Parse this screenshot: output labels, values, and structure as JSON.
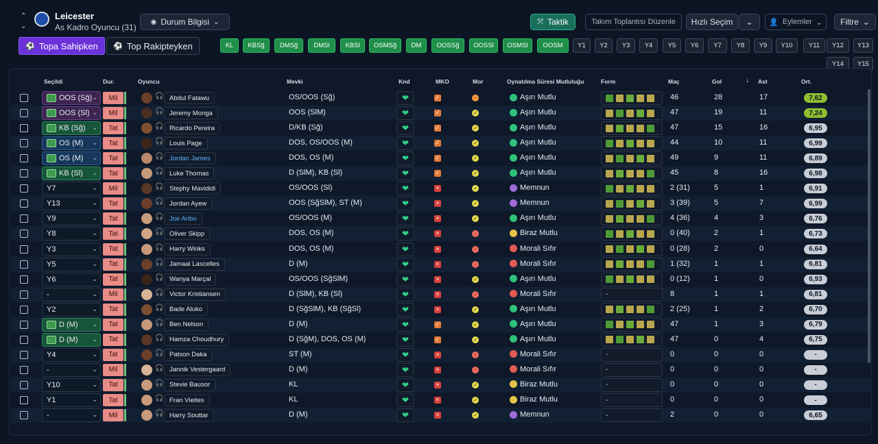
{
  "header": {
    "team": "Leicester",
    "squad": "As Kadro Oyuncu (31)",
    "view": "Durum Bilgisi"
  },
  "toolbar": {
    "tactic": "Taktik",
    "meeting": "Takım Toplantısı Düzenle",
    "quick": "Hızlı Seçim",
    "actions": "Eylemler",
    "filter": "Filtre"
  },
  "toggle": {
    "possession": "Topa Sahipken",
    "opponent": "Top Rakipteyken"
  },
  "formation_pills": [
    {
      "label": "KL",
      "green": true
    },
    {
      "label": "KBSğ",
      "green": true
    },
    {
      "label": "DMSğ",
      "green": true
    },
    {
      "label": "DMSl",
      "green": true
    },
    {
      "label": "KBSl",
      "green": true
    },
    {
      "label": "OSMSğ",
      "green": true
    },
    {
      "label": "DM",
      "green": true
    },
    {
      "label": "OOSSğ",
      "green": true
    },
    {
      "label": "OOSSl",
      "green": true
    },
    {
      "label": "OSMSl",
      "green": true
    },
    {
      "label": "OOSM",
      "green": true
    },
    {
      "label": "Y1",
      "green": false
    },
    {
      "label": "Y2",
      "green": false
    },
    {
      "label": "Y3",
      "green": false
    },
    {
      "label": "Y4",
      "green": false
    },
    {
      "label": "Y5",
      "green": false
    },
    {
      "label": "Y6",
      "green": false
    },
    {
      "label": "Y7",
      "green": false
    },
    {
      "label": "Y8",
      "green": false
    },
    {
      "label": "Y9",
      "green": false
    },
    {
      "label": "Y10",
      "green": false
    },
    {
      "label": "Y11",
      "green": false
    },
    {
      "label": "Y12",
      "green": false
    },
    {
      "label": "Y13",
      "green": false
    },
    {
      "label": "Y14",
      "green": false
    },
    {
      "label": "Y15",
      "green": false
    }
  ],
  "columns": {
    "selected": "Seçildi",
    "dur": "Dur.",
    "player": "Oyuncu",
    "position": "Mevki",
    "knd": "Knd",
    "mko": "MKO",
    "mor": "Mor",
    "playtime": "Oynatılma Süresi Mutluluğu",
    "form": "Form",
    "apps": "Maç",
    "goals": "Gol",
    "assists": "Ast",
    "avg": "Ort."
  },
  "colors": {
    "accent": "#6a32d8",
    "teal": "#1a6e5c",
    "green_pill": "#1f8f4a",
    "rating_high": "#8fbf2f",
    "rating_mid": "#c9ced6"
  },
  "rows": [
    {
      "sel": "OOS (Sğ)",
      "selType": "p",
      "dur": "Mil",
      "name": "Abdul Fatawu",
      "link": false,
      "pos": "OS/OOS (Sğ)",
      "mko": "v",
      "mor": "o",
      "mood": "Aşırı Mutlu",
      "moodType": "g",
      "form": "5",
      "apps": "46",
      "goals": "28",
      "assists": "17",
      "avg": "7,62",
      "hi": true
    },
    {
      "sel": "OOS (Sl)",
      "selType": "p",
      "dur": "Mil",
      "name": "Jeremy Monga",
      "link": false,
      "pos": "OOS (SlM)",
      "mko": "v",
      "mor": "y",
      "mood": "Aşırı Mutlu",
      "moodType": "g",
      "form": "5",
      "apps": "47",
      "goals": "19",
      "assists": "11",
      "avg": "7,24",
      "hi": true
    },
    {
      "sel": "KB (Sğ)",
      "selType": "g",
      "dur": "Tat",
      "name": "Ricardo Pereira",
      "link": false,
      "pos": "D/KB (Sğ)",
      "mko": "v",
      "mor": "y",
      "mood": "Aşırı Mutlu",
      "moodType": "g",
      "form": "5",
      "apps": "47",
      "goals": "15",
      "assists": "16",
      "avg": "6,95",
      "hi": false
    },
    {
      "sel": "OS (M)",
      "selType": "b",
      "dur": "Tat",
      "name": "Louis Page",
      "link": false,
      "pos": "DOS, OS/OOS (M)",
      "mko": "v",
      "mor": "y",
      "mood": "Aşırı Mutlu",
      "moodType": "g",
      "form": "5",
      "apps": "44",
      "goals": "10",
      "assists": "11",
      "avg": "6,99",
      "hi": false
    },
    {
      "sel": "OS (M)",
      "selType": "b",
      "dur": "Tat",
      "name": "Jordan James",
      "link": true,
      "pos": "DOS, OS (M)",
      "mko": "v",
      "mor": "y",
      "mood": "Aşırı Mutlu",
      "moodType": "g",
      "form": "5",
      "apps": "49",
      "goals": "9",
      "assists": "11",
      "avg": "6,89",
      "hi": false
    },
    {
      "sel": "KB (Sl)",
      "selType": "g",
      "dur": "Tat",
      "name": "Luke Thomas",
      "link": false,
      "pos": "D (SlM), KB (Sl)",
      "mko": "v",
      "mor": "y",
      "mood": "Aşırı Mutlu",
      "moodType": "g",
      "form": "5",
      "apps": "45",
      "goals": "8",
      "assists": "16",
      "avg": "6,98",
      "hi": false
    },
    {
      "sel": "Y7",
      "selType": "n",
      "dur": "Mil",
      "name": "Stephy Mavididi",
      "link": false,
      "pos": "OS/OOS (Sl)",
      "mko": "x",
      "mor": "y",
      "mood": "Memnun",
      "moodType": "p",
      "form": "5",
      "apps": "2 (31)",
      "goals": "5",
      "assists": "1",
      "avg": "6,91",
      "hi": false
    },
    {
      "sel": "Y13",
      "selType": "n",
      "dur": "Tat",
      "name": "Jordan Ayew",
      "link": false,
      "pos": "OOS (SğSlM), ST (M)",
      "mko": "x",
      "mor": "y",
      "mood": "Memnun",
      "moodType": "p",
      "form": "5",
      "apps": "3 (39)",
      "goals": "5",
      "assists": "7",
      "avg": "6,99",
      "hi": false
    },
    {
      "sel": "Y9",
      "selType": "n",
      "dur": "Tat",
      "name": "Joe Aribo",
      "link": true,
      "pos": "OS/OOS (M)",
      "mko": "x",
      "mor": "y",
      "mood": "Aşırı Mutlu",
      "moodType": "g",
      "form": "5",
      "apps": "4 (36)",
      "goals": "4",
      "assists": "3",
      "avg": "6,76",
      "hi": false
    },
    {
      "sel": "Y8",
      "selType": "n",
      "dur": "Tat",
      "name": "Oliver Skipp",
      "link": false,
      "pos": "DOS, OS (M)",
      "mko": "x",
      "mor": "r",
      "mood": "Biraz Mutlu",
      "moodType": "y",
      "form": "5",
      "apps": "0 (40)",
      "goals": "2",
      "assists": "1",
      "avg": "6,73",
      "hi": false
    },
    {
      "sel": "Y3",
      "selType": "n",
      "dur": "Tat",
      "name": "Harry Winks",
      "link": false,
      "pos": "DOS, OS (M)",
      "mko": "x",
      "mor": "r",
      "mood": "Morali Sıfır",
      "moodType": "r",
      "form": "5",
      "apps": "0 (28)",
      "goals": "2",
      "assists": "0",
      "avg": "6,64",
      "hi": false
    },
    {
      "sel": "Y5",
      "selType": "n",
      "dur": "Tat",
      "name": "Jamaal Lascelles",
      "link": false,
      "pos": "D (M)",
      "mko": "x",
      "mor": "r",
      "mood": "Morali Sıfır",
      "moodType": "r",
      "form": "5",
      "apps": "1 (32)",
      "goals": "1",
      "assists": "1",
      "avg": "6,81",
      "hi": false
    },
    {
      "sel": "Y6",
      "selType": "n",
      "dur": "Tat",
      "name": "Wanya Marçal",
      "link": false,
      "pos": "OS/OOS (SğSlM)",
      "mko": "x",
      "mor": "y",
      "mood": "Aşırı Mutlu",
      "moodType": "g",
      "form": "5",
      "apps": "0 (12)",
      "goals": "1",
      "assists": "0",
      "avg": "6,93",
      "hi": false
    },
    {
      "sel": "-",
      "selType": "n",
      "dur": "Mil",
      "name": "Victor Kristiansen",
      "link": false,
      "pos": "D (SlM), KB (Sl)",
      "mko": "x",
      "mor": "r",
      "mood": "Morali Sıfır",
      "moodType": "r",
      "form": "-",
      "apps": "8",
      "goals": "1",
      "assists": "1",
      "avg": "6,81",
      "hi": false
    },
    {
      "sel": "Y2",
      "selType": "n",
      "dur": "Tat",
      "name": "Bade Aluko",
      "link": false,
      "pos": "D (SğSlM), KB (SğSl)",
      "mko": "x",
      "mor": "y",
      "mood": "Aşırı Mutlu",
      "moodType": "g",
      "form": "5",
      "apps": "2 (25)",
      "goals": "1",
      "assists": "2",
      "avg": "6,70",
      "hi": false
    },
    {
      "sel": "D (M)",
      "selType": "g",
      "dur": "Tat",
      "name": "Ben Nelson",
      "link": false,
      "pos": "D (M)",
      "mko": "v",
      "mor": "y",
      "mood": "Aşırı Mutlu",
      "moodType": "g",
      "form": "5",
      "apps": "47",
      "goals": "1",
      "assists": "3",
      "avg": "6,79",
      "hi": false
    },
    {
      "sel": "D (M)",
      "selType": "g",
      "dur": "Tat",
      "name": "Hamza Choudhury",
      "link": false,
      "pos": "D (SğM), DOS, OS (M)",
      "mko": "v",
      "mor": "y",
      "mood": "Aşırı Mutlu",
      "moodType": "g",
      "form": "5",
      "apps": "47",
      "goals": "0",
      "assists": "4",
      "avg": "6,75",
      "hi": false
    },
    {
      "sel": "Y4",
      "selType": "n",
      "dur": "Tat",
      "name": "Patson Daka",
      "link": false,
      "pos": "ST (M)",
      "mko": "x",
      "mor": "r",
      "mood": "Morali Sıfır",
      "moodType": "r",
      "form": "-",
      "apps": "0",
      "goals": "0",
      "assists": "0",
      "avg": "-",
      "hi": false
    },
    {
      "sel": "-",
      "selType": "n",
      "dur": "Mil",
      "name": "Jannik Vestergaard",
      "link": false,
      "pos": "D (M)",
      "mko": "x",
      "mor": "r",
      "mood": "Morali Sıfır",
      "moodType": "r",
      "form": "-",
      "apps": "0",
      "goals": "0",
      "assists": "0",
      "avg": "-",
      "hi": false
    },
    {
      "sel": "Y10",
      "selType": "n",
      "dur": "Tat",
      "name": "Stevie Bausor",
      "link": false,
      "pos": "KL",
      "mko": "x",
      "mor": "y",
      "mood": "Biraz Mutlu",
      "moodType": "y",
      "form": "-",
      "apps": "0",
      "goals": "0",
      "assists": "0",
      "avg": "-",
      "hi": false
    },
    {
      "sel": "Y1",
      "selType": "n",
      "dur": "Tat",
      "name": "Fran Vieites",
      "link": false,
      "pos": "KL",
      "mko": "x",
      "mor": "y",
      "mood": "Biraz Mutlu",
      "moodType": "y",
      "form": "-",
      "apps": "0",
      "goals": "0",
      "assists": "0",
      "avg": "-",
      "hi": false
    },
    {
      "sel": "-",
      "selType": "n",
      "dur": "Mil",
      "name": "Harry Souttar",
      "link": false,
      "pos": "D (M)",
      "mko": "x",
      "mor": "y",
      "mood": "Memnun",
      "moodType": "p",
      "form": "-",
      "apps": "2",
      "goals": "0",
      "assists": "0",
      "avg": "6,65",
      "hi": false
    }
  ]
}
